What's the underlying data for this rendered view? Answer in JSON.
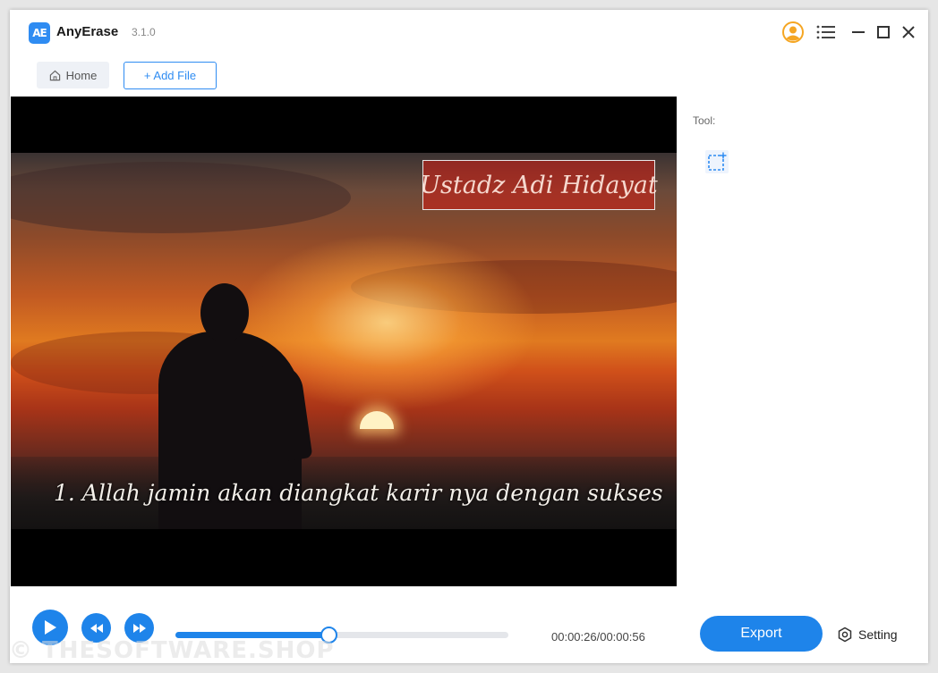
{
  "app": {
    "name": "AnyErase",
    "version": "3.1.0",
    "logo_text": "AE"
  },
  "titlebar": {
    "icons": [
      "user-icon",
      "menu-icon",
      "minimize-icon",
      "maximize-icon",
      "close-icon"
    ]
  },
  "nav": {
    "home_label": "Home",
    "add_file_label": "+ Add File"
  },
  "video": {
    "watermark_text": "Ustadz Adi Hidayat",
    "subtitle_text": "1. Allah jamin akan diangkat karir nya dengan sukses"
  },
  "tool_panel": {
    "label": "Tool:",
    "tools": [
      "rect-select-icon"
    ]
  },
  "playback": {
    "current_time": "00:00:26",
    "total_time": "00:00:56",
    "time_display": "00:00:26/00:00:56",
    "progress_fraction": 0.46
  },
  "actions": {
    "export_label": "Export",
    "setting_label": "Setting"
  },
  "watermark_overlay": "© THESOFTWARE.SHOP",
  "colors": {
    "accent": "#1e84ea",
    "logo": "#2f8cf2",
    "avatar": "#f5a623",
    "selection_fill": "#d21e14"
  }
}
